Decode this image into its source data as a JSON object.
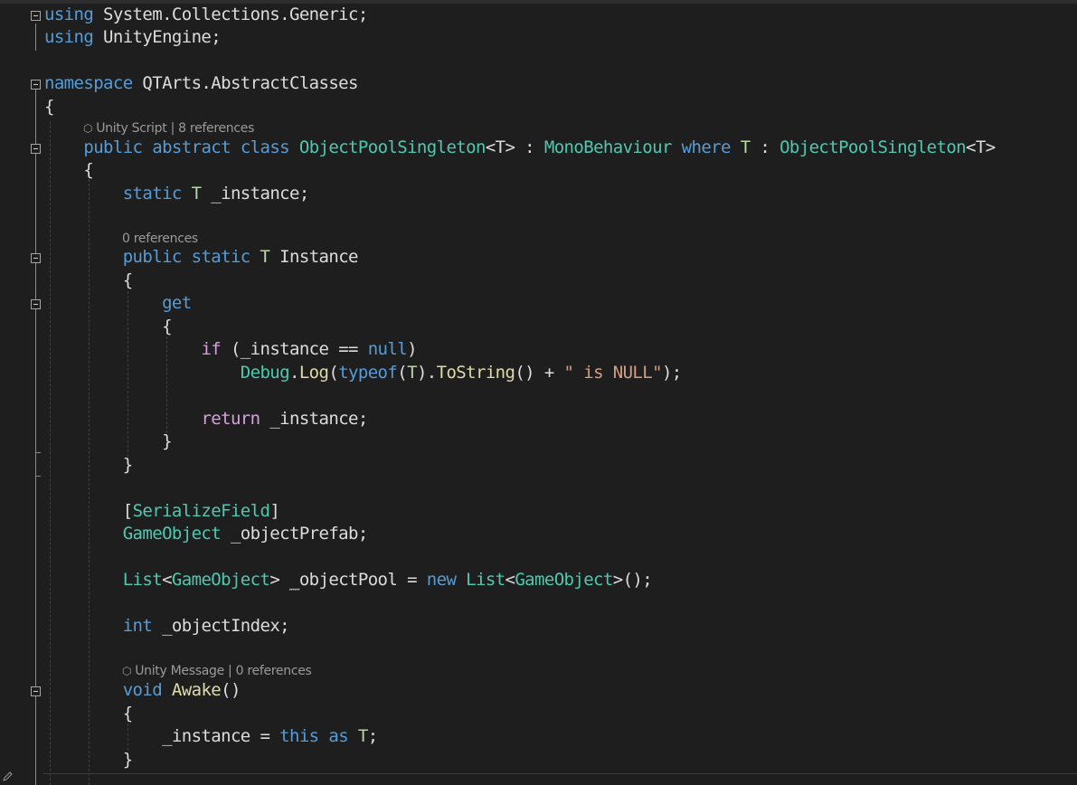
{
  "editor": {
    "codelens": {
      "class": {
        "icon": "unity-cube-icon",
        "kind": "Unity Script",
        "sep": "|",
        "refs": "8 references"
      },
      "instance": {
        "refs": "0 references"
      },
      "awake": {
        "icon": "unity-cube-icon",
        "kind": "Unity Message",
        "sep": "|",
        "refs": "0 references"
      }
    },
    "code": {
      "l1": {
        "kw": "using",
        "rest": " System.Collections.Generic;"
      },
      "l2": {
        "kw": "using",
        "rest": " UnityEngine;"
      },
      "l4": {
        "kw": "namespace",
        "rest": " QTArts.AbstractClasses"
      },
      "l5": {
        "brace": "{"
      },
      "l7": {
        "mod1": "public",
        "mod2": "abstract",
        "mod3": "class",
        "name": "ObjectPoolSingleton",
        "tparam": "<T>",
        "colon": " : ",
        "base": "MonoBehaviour",
        "where": "where",
        "tvar": "T",
        "colon2": " : ",
        "constraint": "ObjectPoolSingleton",
        "tparam2": "<T>"
      },
      "l8": {
        "brace": "{"
      },
      "l9": {
        "kw": "static",
        "tvar": "T",
        "rest": " _instance;"
      },
      "l11": {
        "mod1": "public",
        "mod2": "static",
        "tvar": "T",
        "name": " Instance"
      },
      "l12": {
        "brace": "{"
      },
      "l13": {
        "kw": "get"
      },
      "l14": {
        "brace": "{"
      },
      "l15": {
        "kw": "if",
        "pre": " (_instance == ",
        "null": "null",
        "post": ")"
      },
      "l16": {
        "cls": "Debug",
        "dot": ".",
        "method": "Log",
        "p1": "(",
        "typeof": "typeof",
        "p2": "(",
        "tvar": "T",
        "p3": ").",
        "method2": "ToString",
        "p4": "() + ",
        "str": "\" is NULL\"",
        "p5": ");"
      },
      "l18": {
        "kw": "return",
        "rest": " _instance;"
      },
      "l19": {
        "brace": "}"
      },
      "l20": {
        "brace": "}"
      },
      "l22": {
        "b1": "[",
        "attr": "SerializeField",
        "b2": "]"
      },
      "l23": {
        "ty": "GameObject",
        "rest": " _objectPrefab;"
      },
      "l25": {
        "ty1": "List",
        "lt": "<",
        "ty2": "GameObject",
        "gt": "> ",
        "field_first": "_",
        "field_rest": "objectPool",
        "eq": " = ",
        "kw": "new",
        "sp": " ",
        "ty3": "List",
        "lt2": "<",
        "ty4": "GameObject",
        "end": ">();"
      },
      "l27": {
        "kw": "int",
        "rest": " _objectIndex;"
      },
      "l29": {
        "kw": "void",
        "method": "Awake",
        "rest": "()"
      },
      "l30": {
        "brace": "{"
      },
      "l31": {
        "pre": "_instance = ",
        "this": "this",
        "sp": " ",
        "as": "as",
        "sp2": " ",
        "tvar": "T",
        "end": ";"
      },
      "l32": {
        "brace": "}"
      }
    }
  }
}
